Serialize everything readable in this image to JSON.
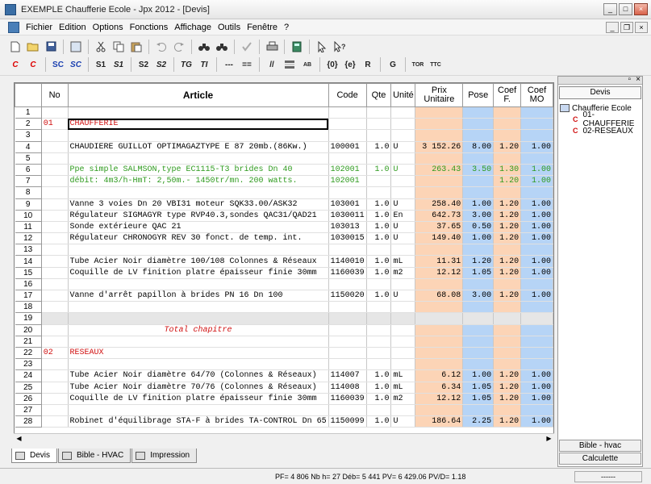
{
  "window": {
    "title": "EXEMPLE Chaufferie Ecole - Jpx 2012 - [Devis]",
    "controls": [
      "_",
      "□",
      "×"
    ]
  },
  "menu": {
    "items": [
      "Fichier",
      "Edition",
      "Options",
      "Fonctions",
      "Affichage",
      "Outils",
      "Fenêtre",
      "?"
    ],
    "mdi_controls": [
      "_",
      "❐",
      "×"
    ]
  },
  "toolbar2": {
    "labels": [
      "C",
      "C",
      "SC",
      "SC",
      "S1",
      "S1",
      "S2",
      "S2",
      "TG",
      "TI",
      "---",
      "==",
      "//",
      "AB",
      "{0}",
      "{e}",
      "R",
      "G",
      "TOR",
      "TTC"
    ]
  },
  "grid": {
    "headers": {
      "no": "No",
      "article": "Article",
      "code": "Code",
      "qte": "Qte",
      "unite": "Unité",
      "prix": "Prix Unitaire",
      "pose": "Pose",
      "coeff": "Coef F.",
      "coefmo": "Coef MO"
    },
    "rows": [
      {
        "n": "1",
        "no": "",
        "article": "",
        "code": "",
        "qte": "",
        "unite": "",
        "prix": "",
        "pose": "",
        "coeff": "",
        "coefmo": "",
        "style": ""
      },
      {
        "n": "2",
        "no": "01",
        "article": "CHAUFFERIE",
        "code": "",
        "qte": "",
        "unite": "",
        "prix": "",
        "pose": "",
        "coeff": "",
        "coefmo": "",
        "style": "red"
      },
      {
        "n": "3",
        "no": "",
        "article": "",
        "code": "",
        "qte": "",
        "unite": "",
        "prix": "",
        "pose": "",
        "coeff": "",
        "coefmo": "",
        "style": ""
      },
      {
        "n": "4",
        "no": "",
        "article": "CHAUDIERE GUILLOT OPTIMAGAZTYPE E 87 20mb.(86Kw.)",
        "code": "100001",
        "qte": "1.0",
        "unite": "U",
        "prix": "3 152.26",
        "pose": "8.00",
        "coeff": "1.20",
        "coefmo": "1.00",
        "style": ""
      },
      {
        "n": "5",
        "no": "",
        "article": "",
        "code": "",
        "qte": "",
        "unite": "",
        "prix": "",
        "pose": "",
        "coeff": "",
        "coefmo": "",
        "style": ""
      },
      {
        "n": "6",
        "no": "",
        "article": "Ppe simple SALMSON,type EC1115-T3 brides Dn 40",
        "code": "102001",
        "qte": "1.0",
        "unite": "U",
        "prix": "263.43",
        "pose": "3.50",
        "coeff": "1.30",
        "coefmo": "1.00",
        "style": "green"
      },
      {
        "n": "7",
        "no": "",
        "article": "débit: 4m3/h-HmT: 2,50m.- 1450tr/mn. 200 watts.",
        "code": "102001",
        "qte": "",
        "unite": "",
        "prix": "",
        "pose": "",
        "coeff": "1.20",
        "coefmo": "1.00",
        "style": "green"
      },
      {
        "n": "8",
        "no": "",
        "article": "",
        "code": "",
        "qte": "",
        "unite": "",
        "prix": "",
        "pose": "",
        "coeff": "",
        "coefmo": "",
        "style": ""
      },
      {
        "n": "9",
        "no": "",
        "article": "Vanne 3 voies Dn 20 VBI31 moteur SQK33.00/ASK32",
        "code": "103001",
        "qte": "1.0",
        "unite": "U",
        "prix": "258.40",
        "pose": "1.00",
        "coeff": "1.20",
        "coefmo": "1.00",
        "style": ""
      },
      {
        "n": "10",
        "no": "",
        "article": "Régulateur SIGMAGYR type RVP40.3,sondes QAC31/QAD21",
        "code": "1030011",
        "qte": "1.0",
        "unite": "En",
        "prix": "642.73",
        "pose": "3.00",
        "coeff": "1.20",
        "coefmo": "1.00",
        "style": ""
      },
      {
        "n": "11",
        "no": "",
        "article": "Sonde extérieure QAC 21",
        "code": "103013",
        "qte": "1.0",
        "unite": "U",
        "prix": "37.65",
        "pose": "0.50",
        "coeff": "1.20",
        "coefmo": "1.00",
        "style": ""
      },
      {
        "n": "12",
        "no": "",
        "article": "Régulateur CHRONOGYR REV 30 fonct. de temp. int.",
        "code": "1030015",
        "qte": "1.0",
        "unite": "U",
        "prix": "149.40",
        "pose": "1.00",
        "coeff": "1.20",
        "coefmo": "1.00",
        "style": ""
      },
      {
        "n": "13",
        "no": "",
        "article": "",
        "code": "",
        "qte": "",
        "unite": "",
        "prix": "",
        "pose": "",
        "coeff": "",
        "coefmo": "",
        "style": ""
      },
      {
        "n": "14",
        "no": "",
        "article": "Tube Acier Noir diamètre 100/108 Colonnes & Réseaux",
        "code": "1140010",
        "qte": "1.0",
        "unite": "mL",
        "prix": "11.31",
        "pose": "1.20",
        "coeff": "1.20",
        "coefmo": "1.00",
        "style": ""
      },
      {
        "n": "15",
        "no": "",
        "article": "Coquille de LV finition platre épaisseur finie 30mm",
        "code": "1160039",
        "qte": "1.0",
        "unite": "m2",
        "prix": "12.12",
        "pose": "1.05",
        "coeff": "1.20",
        "coefmo": "1.00",
        "style": ""
      },
      {
        "n": "16",
        "no": "",
        "article": "",
        "code": "",
        "qte": "",
        "unite": "",
        "prix": "",
        "pose": "",
        "coeff": "",
        "coefmo": "",
        "style": ""
      },
      {
        "n": "17",
        "no": "",
        "article": "Vanne d'arrêt papillon à brides PN 16 Dn 100",
        "code": "1150020",
        "qte": "1.0",
        "unite": "U",
        "prix": "68.08",
        "pose": "3.00",
        "coeff": "1.20",
        "coefmo": "1.00",
        "style": ""
      },
      {
        "n": "18",
        "no": "",
        "article": "",
        "code": "",
        "qte": "",
        "unite": "",
        "prix": "",
        "pose": "",
        "coeff": "",
        "coefmo": "",
        "style": ""
      },
      {
        "n": "19",
        "no": "",
        "article": "",
        "code": "",
        "qte": "",
        "unite": "",
        "prix": "",
        "pose": "",
        "coeff": "",
        "coefmo": "",
        "style": "gray"
      },
      {
        "n": "20",
        "no": "",
        "article": "Total chapitre",
        "code": "",
        "qte": "",
        "unite": "",
        "prix": "",
        "pose": "",
        "coeff": "",
        "coefmo": "",
        "style": "total"
      },
      {
        "n": "21",
        "no": "",
        "article": "",
        "code": "",
        "qte": "",
        "unite": "",
        "prix": "",
        "pose": "",
        "coeff": "",
        "coefmo": "",
        "style": ""
      },
      {
        "n": "22",
        "no": "02",
        "article": "RESEAUX",
        "code": "",
        "qte": "",
        "unite": "",
        "prix": "",
        "pose": "",
        "coeff": "",
        "coefmo": "",
        "style": "red"
      },
      {
        "n": "23",
        "no": "",
        "article": "",
        "code": "",
        "qte": "",
        "unite": "",
        "prix": "",
        "pose": "",
        "coeff": "",
        "coefmo": "",
        "style": ""
      },
      {
        "n": "24",
        "no": "",
        "article": "Tube Acier Noir diamètre 64/70 (Colonnes & Réseaux)",
        "code": "114007",
        "qte": "1.0",
        "unite": "mL",
        "prix": "6.12",
        "pose": "1.00",
        "coeff": "1.20",
        "coefmo": "1.00",
        "style": ""
      },
      {
        "n": "25",
        "no": "",
        "article": "Tube Acier Noir diamètre 70/76 (Colonnes & Réseaux)",
        "code": "114008",
        "qte": "1.0",
        "unite": "mL",
        "prix": "6.34",
        "pose": "1.05",
        "coeff": "1.20",
        "coefmo": "1.00",
        "style": ""
      },
      {
        "n": "26",
        "no": "",
        "article": "Coquille de LV finition platre épaisseur finie 30mm",
        "code": "1160039",
        "qte": "1.0",
        "unite": "m2",
        "prix": "12.12",
        "pose": "1.05",
        "coeff": "1.20",
        "coefmo": "1.00",
        "style": ""
      },
      {
        "n": "27",
        "no": "",
        "article": "",
        "code": "",
        "qte": "",
        "unite": "",
        "prix": "",
        "pose": "",
        "coeff": "",
        "coefmo": "",
        "style": ""
      },
      {
        "n": "28",
        "no": "",
        "article": "Robinet d'équilibrage STA-F à brides TA-CONTROL Dn 65",
        "code": "1150099",
        "qte": "1.0",
        "unite": "U",
        "prix": "186.64",
        "pose": "2.25",
        "coeff": "1.20",
        "coefmo": "1.00",
        "style": ""
      }
    ]
  },
  "tabs": [
    "Devis",
    "Bible - HVAC",
    "Impression"
  ],
  "status": {
    "text": "PF= 4 806  Nb h= 27  Déb= 5 441  PV= 6 429.06  PV/D= 1.18",
    "right": "------"
  },
  "panel": {
    "title": "Devis",
    "root": "Chaufferie Ecole",
    "children": [
      {
        "tag": "C",
        "label": "01-CHAUFFERIE"
      },
      {
        "tag": "C",
        "label": "02-RESEAUX"
      }
    ],
    "bottom_buttons": [
      "Bible - hvac",
      "Calculette"
    ]
  }
}
